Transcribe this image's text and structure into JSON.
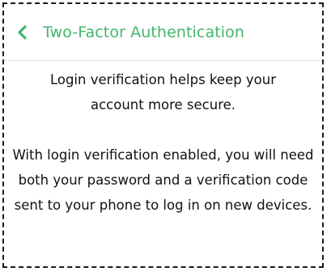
{
  "header": {
    "back_icon": "chevron-left-icon",
    "title": "Two-Factor Authentication",
    "accent_color": "#43b66b"
  },
  "content": {
    "paragraph_1": "Login verification helps keep your account more secure.",
    "paragraph_2": "With login verification enabled, you will need both your password and a verification code sent to your phone to log in on new devices."
  }
}
